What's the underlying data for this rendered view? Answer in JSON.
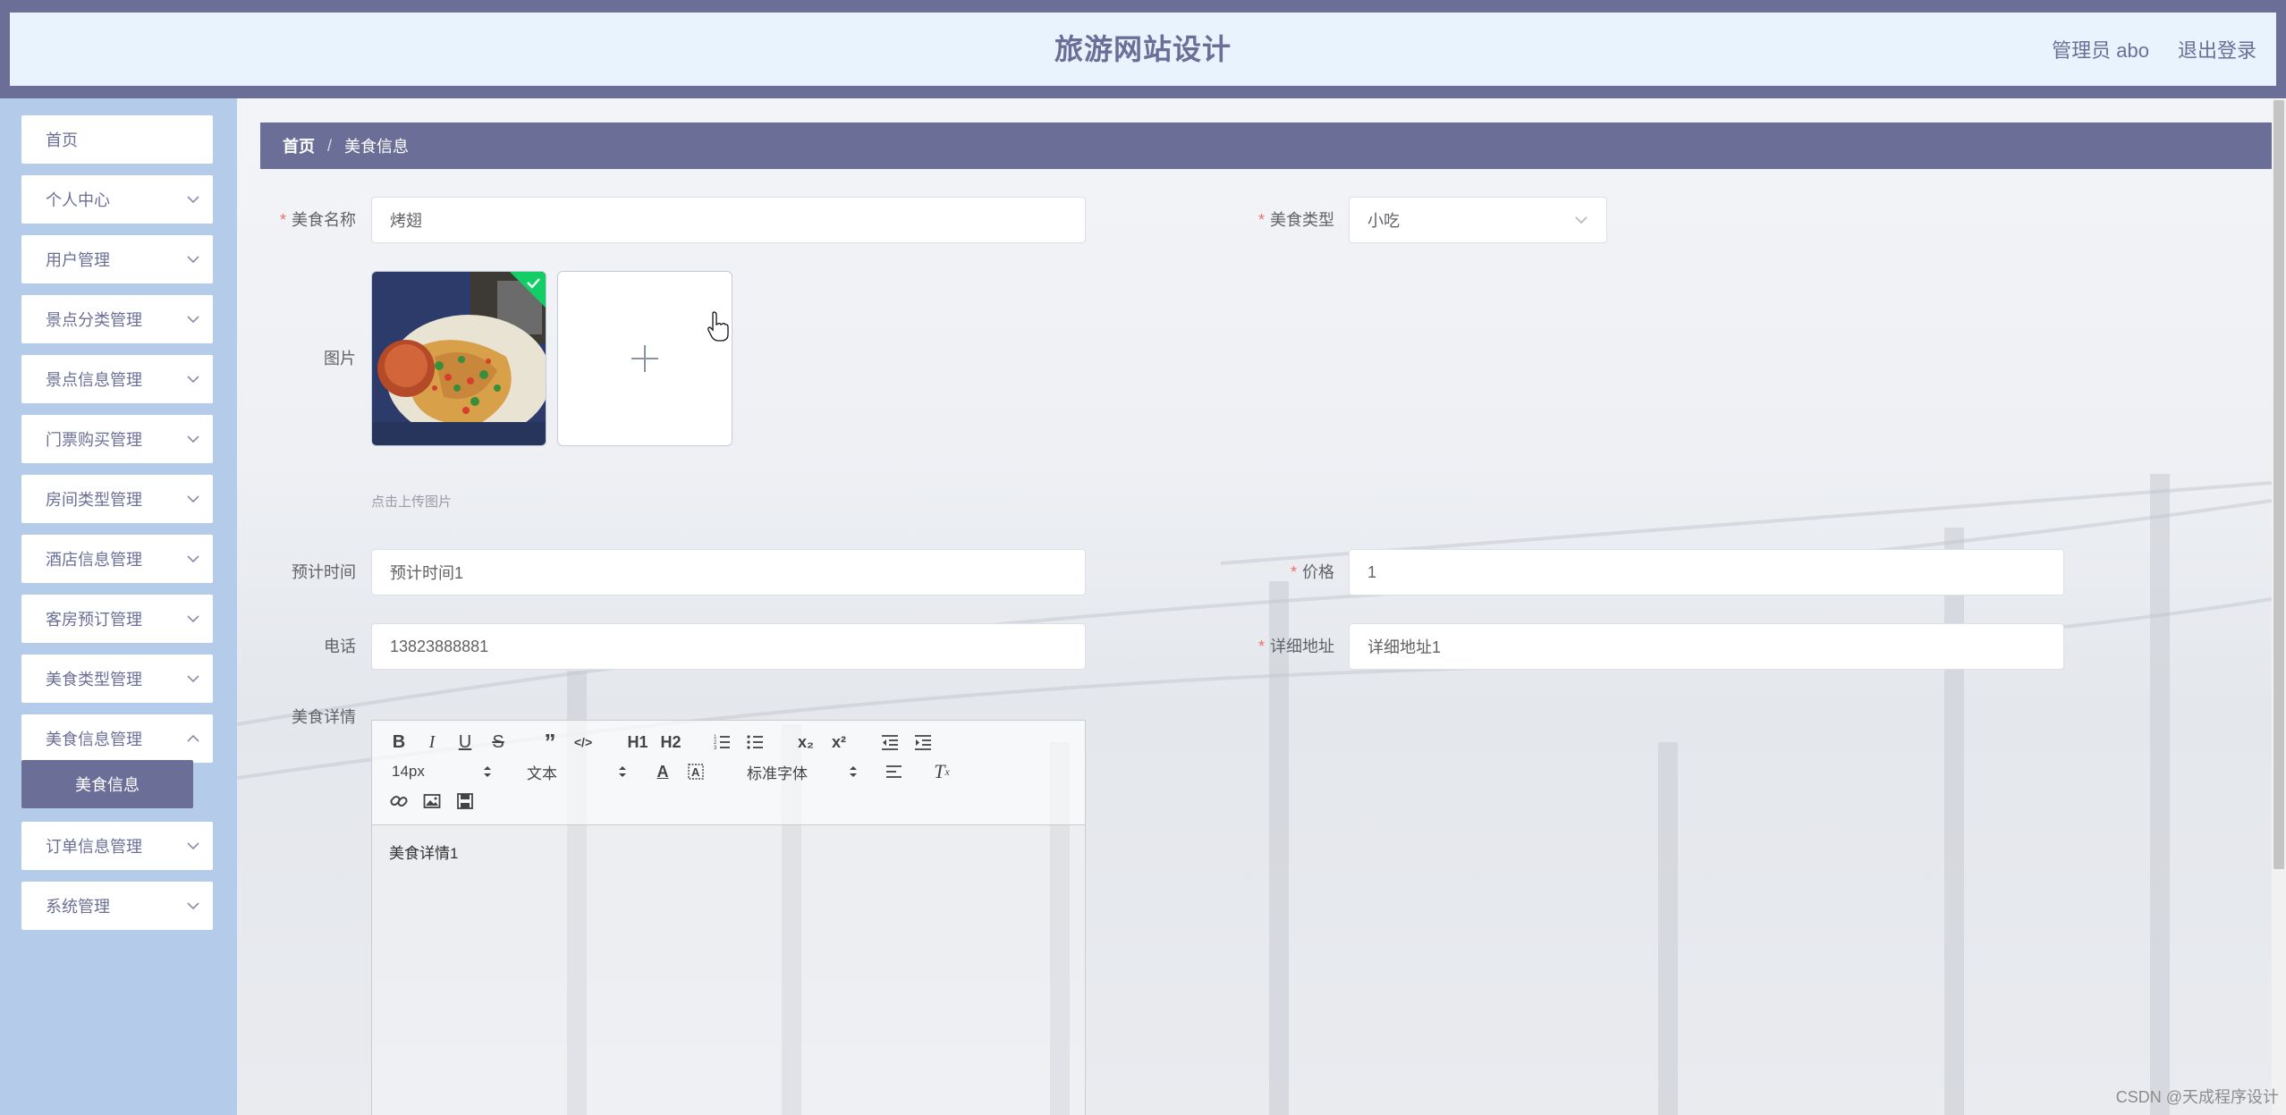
{
  "header": {
    "title": "旅游网站设计",
    "admin": "管理员 abo",
    "logout": "退出登录"
  },
  "sidebar": {
    "items": [
      {
        "label": "首页",
        "has_arrow": false
      },
      {
        "label": "个人中心",
        "has_arrow": true
      },
      {
        "label": "用户管理",
        "has_arrow": true
      },
      {
        "label": "景点分类管理",
        "has_arrow": true
      },
      {
        "label": "景点信息管理",
        "has_arrow": true
      },
      {
        "label": "门票购买管理",
        "has_arrow": true
      },
      {
        "label": "房间类型管理",
        "has_arrow": true
      },
      {
        "label": "酒店信息管理",
        "has_arrow": true
      },
      {
        "label": "客房预订管理",
        "has_arrow": true
      },
      {
        "label": "美食类型管理",
        "has_arrow": true
      },
      {
        "label": "美食信息管理",
        "has_arrow": true
      },
      {
        "label": "订单信息管理",
        "has_arrow": true
      },
      {
        "label": "系统管理",
        "has_arrow": true
      }
    ],
    "active_sub": "美食信息"
  },
  "breadcrumb": {
    "home": "首页",
    "separator": "/",
    "current": "美食信息"
  },
  "form": {
    "name_label": "美食名称",
    "name_value": "烤翅",
    "type_label": "美食类型",
    "type_value": "小吃",
    "image_label": "图片",
    "upload_hint": "点击上传图片",
    "time_label": "预计时间",
    "time_value": "预计时间1",
    "price_label": "价格",
    "price_value": "1",
    "phone_label": "电话",
    "phone_value": "13823888881",
    "address_label": "详细地址",
    "address_value": "详细地址1",
    "detail_label": "美食详情"
  },
  "editor": {
    "size_picker": "14px",
    "header_picker": "文本",
    "font_picker": "标准字体",
    "content": "美食详情1"
  },
  "watermark": "CSDN @天成程序设计",
  "colors": {
    "primary": "#6b6f97",
    "sidebar_bg": "#b4cbe9",
    "header_bg": "#e8f3fe",
    "required": "#f56c6c",
    "success": "#13ce66"
  }
}
